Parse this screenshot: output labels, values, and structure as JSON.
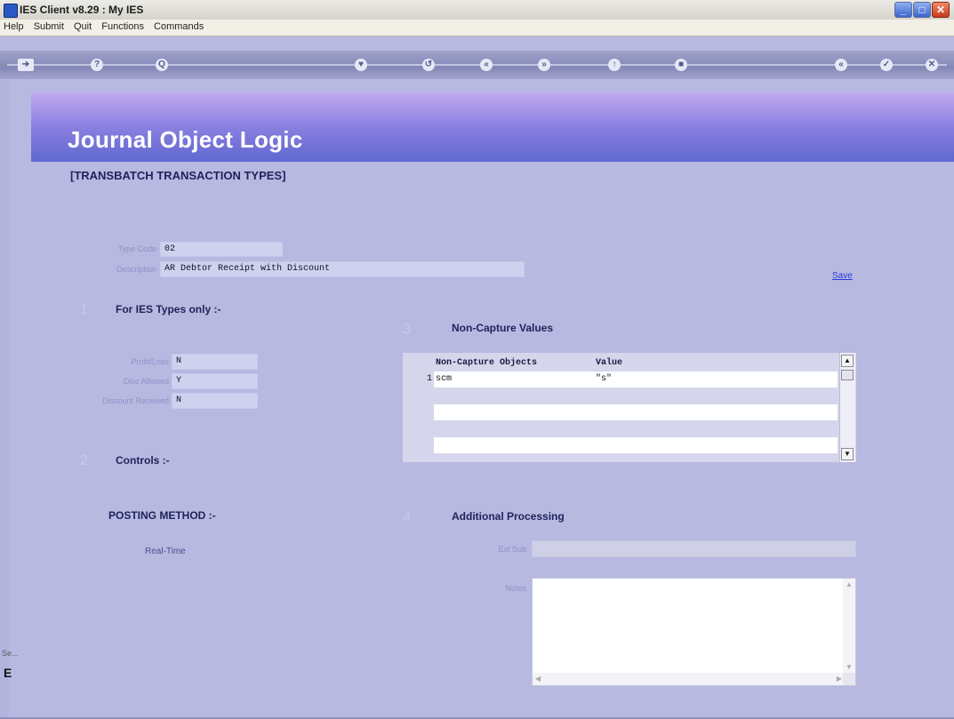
{
  "window": {
    "title": "IES Client v8.29 : My IES"
  },
  "menu": [
    "Help",
    "Submit",
    "Quit",
    "Functions",
    "Commands"
  ],
  "toolbar": {
    "icons": [
      "?",
      "Q",
      "♥",
      "↺",
      "«",
      "»",
      "↑",
      "■",
      "«",
      "✓",
      "✕"
    ]
  },
  "page": {
    "title": "Journal Object Logic",
    "subtitle": "[TRANSBATCH TRANSACTION TYPES]",
    "save_label": "Save"
  },
  "form": {
    "type_code": {
      "label": "Type Code",
      "value": "02"
    },
    "description": {
      "label": "Description",
      "value": "AR Debtor Receipt with Discount"
    }
  },
  "section1": {
    "number": "1",
    "title": "For IES Types only :-",
    "fields": [
      {
        "label": "Profit/Loss",
        "value": "N"
      },
      {
        "label": "Disc Allowed",
        "value": "Y"
      },
      {
        "label": "Discount Received",
        "value": "N"
      }
    ]
  },
  "section2": {
    "number": "2",
    "title": "Controls :-",
    "posting_method": "POSTING METHOD :-",
    "posting_value": "Real-Time"
  },
  "section3": {
    "number": "3",
    "title": "Non-Capture Values",
    "columns": [
      "Non-Capture Objects",
      "Value"
    ],
    "rows": [
      {
        "index": "1",
        "object": "scm",
        "value": "\"s\""
      }
    ]
  },
  "section4": {
    "number": "4",
    "title": "Additional Processing",
    "ext_sub_label": "Ext Sub",
    "notes_label": "Notes"
  },
  "edge": {
    "text_top": "Se...",
    "text_bottom": "E"
  }
}
